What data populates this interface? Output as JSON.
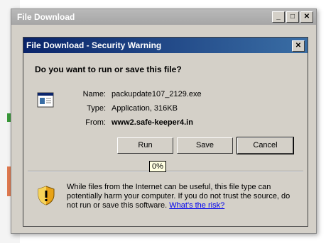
{
  "outer_window": {
    "title": "File Download",
    "buttons": [
      "_",
      "□",
      "✕"
    ]
  },
  "dialog": {
    "title": "File Download - Security Warning",
    "close": "✕",
    "question": "Do you want to run or save this file?",
    "file": {
      "name_label": "Name:",
      "name": "packupdate107_2129.exe",
      "type_label": "Type:",
      "type": "Application, 316KB",
      "from_label": "From:",
      "from": "www2.safe-keeper4.in"
    },
    "buttons": {
      "run": "Run",
      "save": "Save",
      "cancel": "Cancel"
    },
    "progress": "0%",
    "warning_text": "While files from the Internet can be useful, this file type can potentially harm your computer. If you do not trust the source, do not run or save this software.",
    "risk_link": "What's the risk?"
  },
  "colors": {
    "title_active": "#0a246a",
    "title_inactive": "#a6a6a6",
    "dialog_face": "#d4d0c8",
    "link": "#0000ee"
  },
  "icons": [
    "file-application-icon",
    "security-shield-icon"
  ]
}
